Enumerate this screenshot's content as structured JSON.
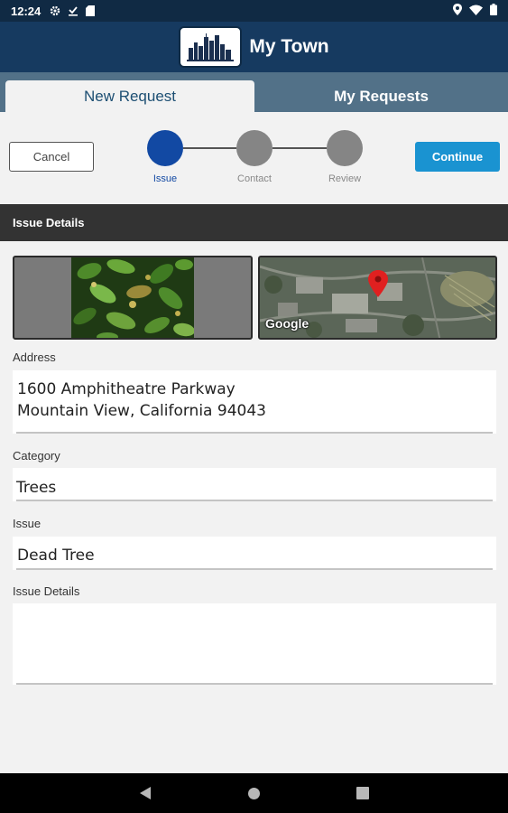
{
  "status_bar": {
    "time": "12:24"
  },
  "app": {
    "title": "My Town"
  },
  "tabs": [
    {
      "label": "New Request",
      "active": true
    },
    {
      "label": "My Requests",
      "active": false
    }
  ],
  "actions": {
    "cancel_label": "Cancel",
    "continue_label": "Continue"
  },
  "steps": [
    {
      "label": "Issue",
      "active": true
    },
    {
      "label": "Contact",
      "active": false
    },
    {
      "label": "Review",
      "active": false
    }
  ],
  "section": {
    "title": "Issue Details"
  },
  "map": {
    "attribution": "Google"
  },
  "form": {
    "address": {
      "label": "Address",
      "line1": "1600 Amphitheatre Parkway",
      "line2": "Mountain View, California 94043"
    },
    "category": {
      "label": "Category",
      "value": "Trees"
    },
    "issue": {
      "label": "Issue",
      "value": "Dead Tree"
    },
    "issue_details": {
      "label": "Issue Details",
      "value": ""
    }
  },
  "colors": {
    "header": "#163a60",
    "tab_bar": "#527188",
    "accent": "#1a93d1",
    "step_active": "#1249a3",
    "step_inactive": "#858585"
  },
  "icons": [
    "settings-icon",
    "download-done-icon",
    "sd-card-icon",
    "location-icon",
    "wifi-icon",
    "battery-icon",
    "back-icon",
    "home-icon",
    "recents-icon",
    "map-pin-icon",
    "city-skyline-logo"
  ]
}
